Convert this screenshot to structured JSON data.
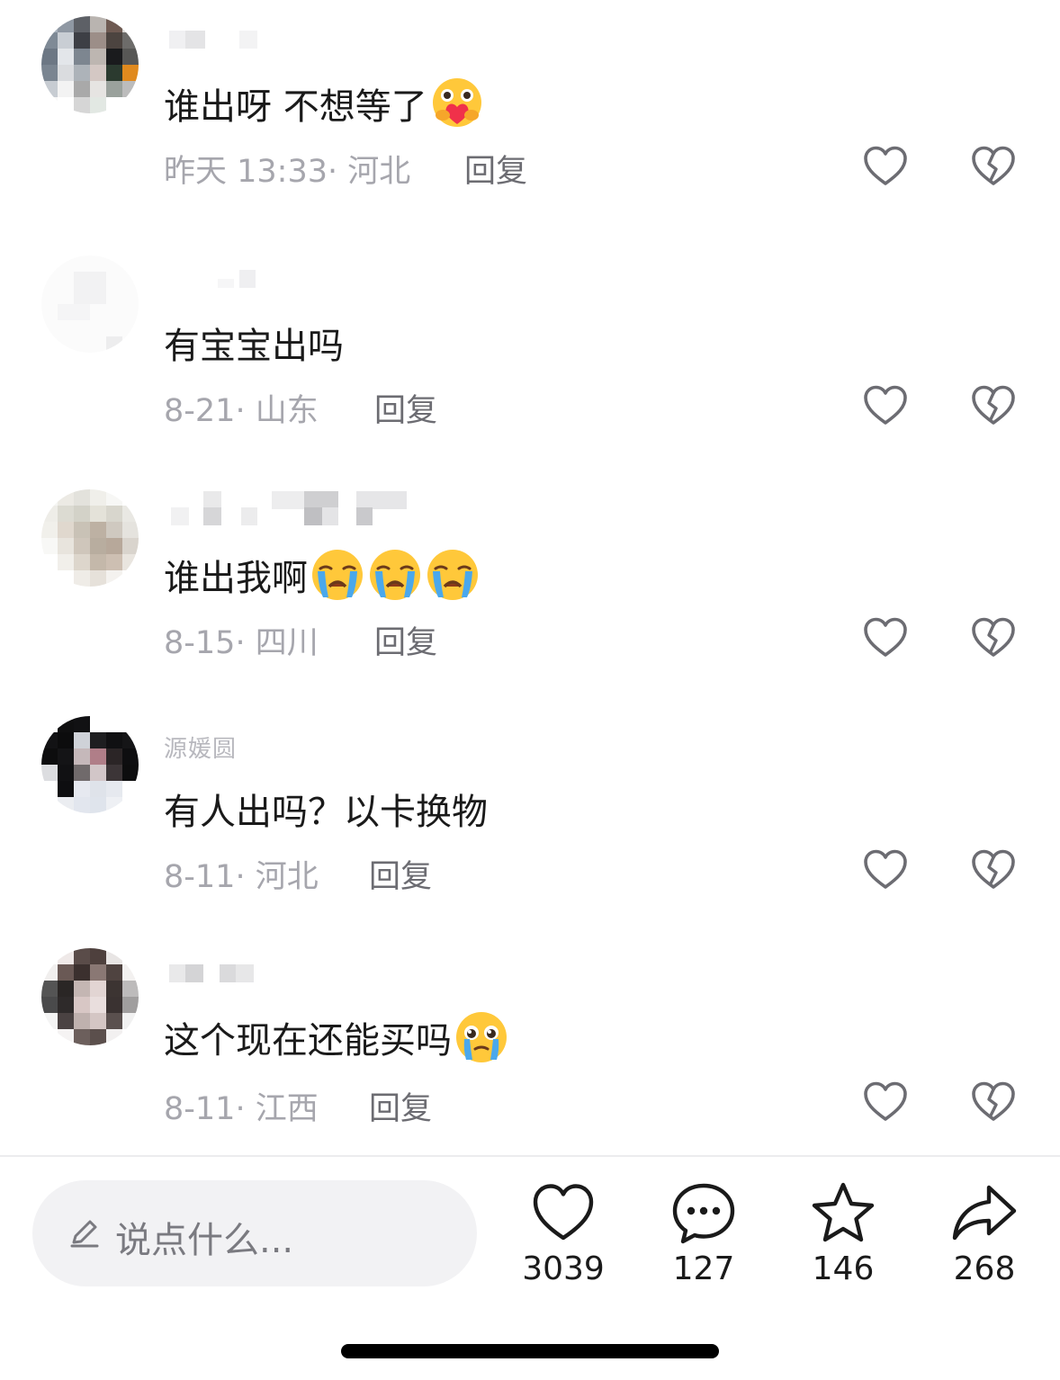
{
  "comments": [
    {
      "username": "",
      "text": "谁出呀 不想等了",
      "emoji": "hug-heart-emoji",
      "time": "昨天 13:33",
      "location": "河北",
      "reply": "回复"
    },
    {
      "username": "",
      "text": "有宝宝出吗",
      "emoji": "",
      "time": "8-21",
      "location": "山东",
      "reply": "回复"
    },
    {
      "username": "",
      "text": "谁出我啊",
      "emoji": "crying-face-emoji x3",
      "time": "8-15",
      "location": "四川",
      "reply": "回复"
    },
    {
      "username": "源媛圆",
      "text": "有人出吗？以卡换物",
      "emoji": "",
      "time": "8-11",
      "location": "河北",
      "reply": "回复"
    },
    {
      "username": "",
      "text": "这个现在还能买吗",
      "emoji": "teary-face-emoji",
      "time": "8-11",
      "location": "江西",
      "reply": "回复"
    }
  ],
  "footer": {
    "input_placeholder": "说点什么...",
    "likes": "3039",
    "comments": "127",
    "favorites": "146",
    "shares": "268"
  },
  "icons": {
    "like": "heart-outline-icon",
    "dislike": "broken-heart-icon",
    "comment": "speech-bubble-icon",
    "favorite": "star-outline-icon",
    "share": "share-arrow-icon",
    "edit": "pencil-icon"
  },
  "colors": {
    "text": "#1a1a1a",
    "meta": "#a6a6ad",
    "reply": "#6c6c72",
    "icon": "#6c6c72",
    "pill": "#f2f2f4"
  }
}
